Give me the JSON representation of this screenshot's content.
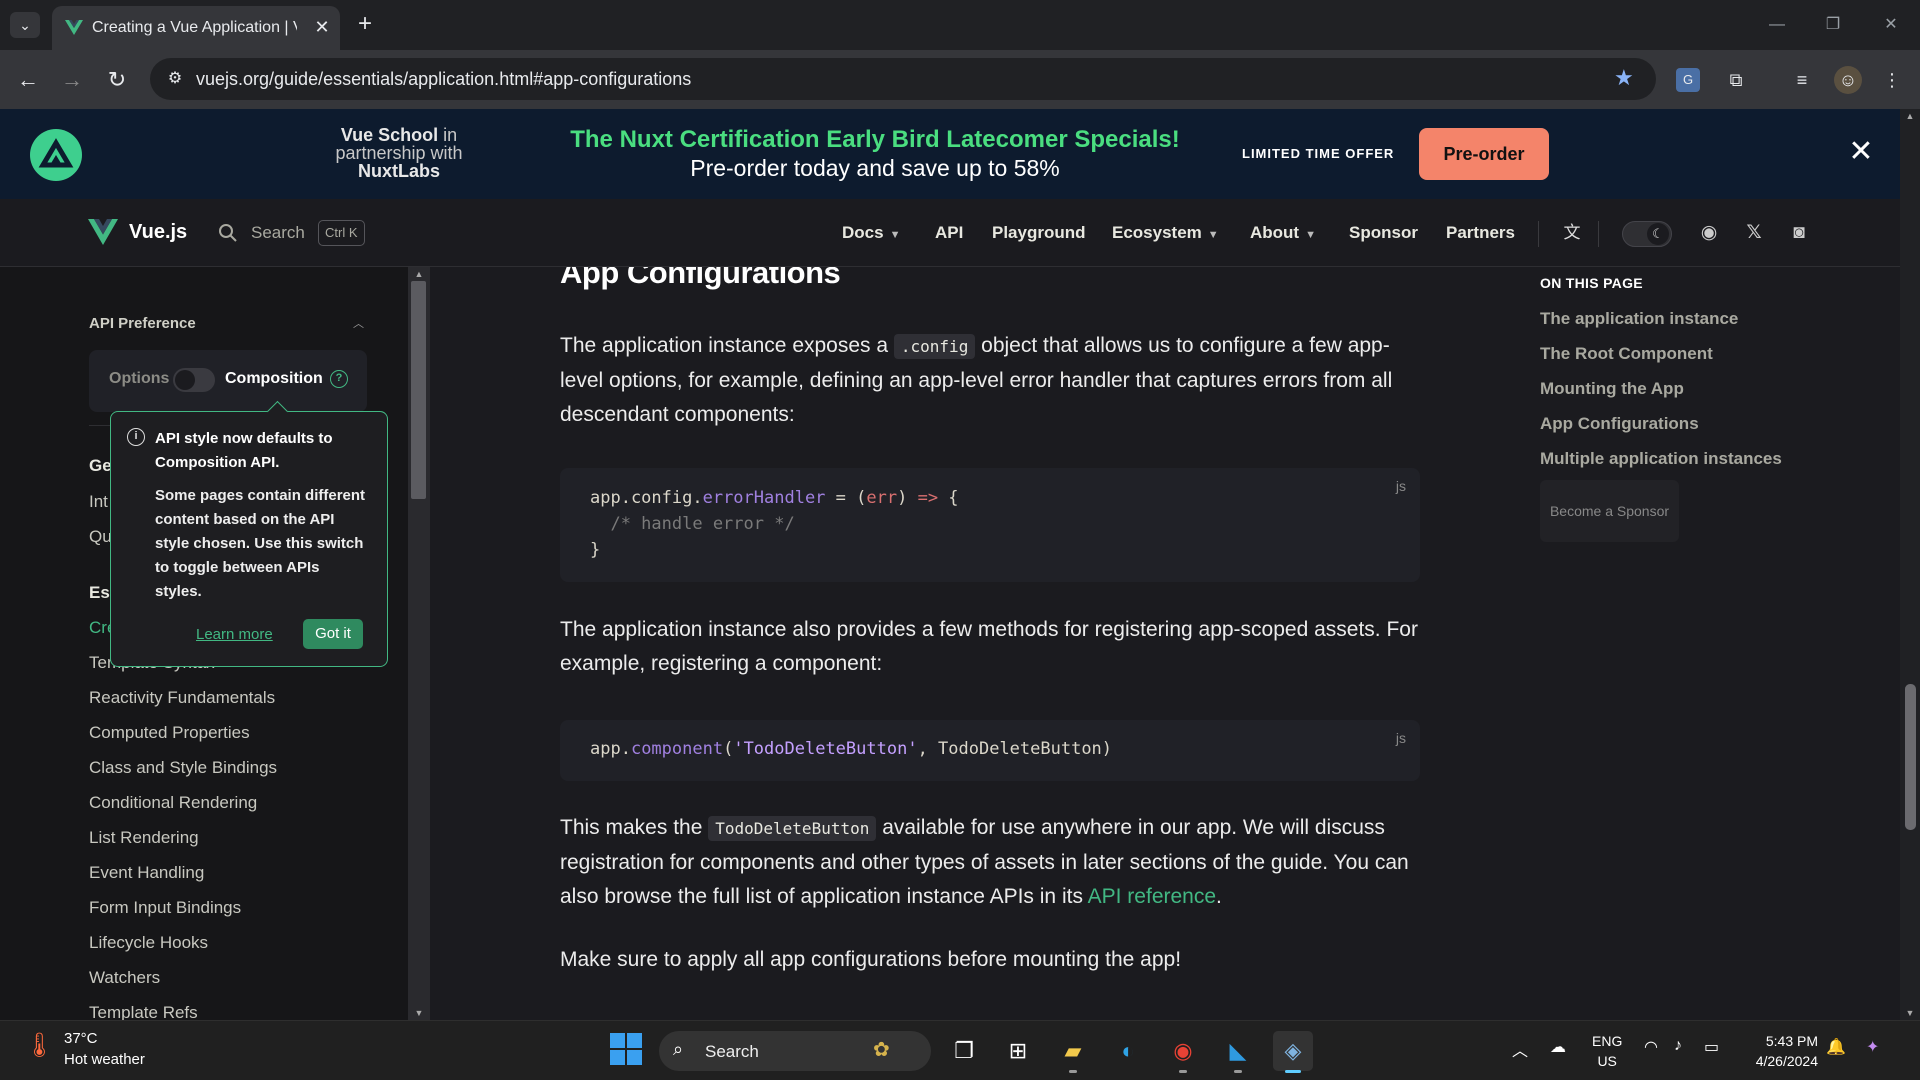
{
  "browser": {
    "tab_title": "Creating a Vue Application | Vue.js",
    "url": "vuejs.org/guide/essentials/application.html#app-configurations",
    "new_tab": "+",
    "close": "✕"
  },
  "banner": {
    "brand_line1": "Vue School",
    "brand_line1_suffix": " in",
    "brand_line2": "partnership with",
    "brand_line3": "NuxtLabs",
    "title": "The Nuxt Certification Early Bird Latecomer Specials!",
    "subtitle": "Pre-order today and save up to 58%",
    "offer": "LIMITED TIME OFFER",
    "cta": "Pre-order"
  },
  "nav": {
    "brand": "Vue.js",
    "search_label": "Search",
    "search_kbd": "Ctrl K",
    "links": [
      "Docs",
      "API",
      "Playground",
      "Ecosystem",
      "About",
      "Sponsor",
      "Partners"
    ]
  },
  "sidebar": {
    "api_pref_title": "API Preference",
    "options_label": "Options",
    "composition_label": "Composition",
    "group_partials": [
      "Ge",
      "Int",
      "Qu",
      "Es",
      "Cre"
    ],
    "template_partial": "Template Syntax",
    "items": [
      "Reactivity Fundamentals",
      "Computed Properties",
      "Class and Style Bindings",
      "Conditional Rendering",
      "List Rendering",
      "Event Handling",
      "Form Input Bindings",
      "Lifecycle Hooks",
      "Watchers",
      "Template Refs"
    ]
  },
  "tooltip": {
    "heading": "API style now defaults to Composition API.",
    "body": "Some pages contain different content based on the API style chosen. Use this switch to toggle between APIs styles.",
    "learn_more": "Learn more",
    "got_it": "Got it"
  },
  "content": {
    "heading": "App Configurations",
    "p1_before": "The application instance exposes a ",
    "p1_code": ".config",
    "p1_after": " object that allows us to configure a few app-level options, for example, defining an app-level error handler that captures errors from all descendant components:",
    "code1_lang": "js",
    "code1": {
      "l1a": "app.config.",
      "l1fn": "errorHandler",
      "l1b": " = (",
      "l1arg": "err",
      "l1c": ") ",
      "l1arrow": "=>",
      "l1d": " {",
      "l2": "  /* handle error */",
      "l3": "}"
    },
    "p2": "The application instance also provides a few methods for registering app-scoped assets. For example, registering a component:",
    "code2_lang": "js",
    "code2": {
      "a": "app.",
      "fn": "component",
      "b": "(",
      "str": "'TodoDeleteButton'",
      "c": ", TodoDeleteButton)"
    },
    "p3_before": "This makes the ",
    "p3_code": "TodoDeleteButton",
    "p3_mid": " available for use anywhere in our app. We will discuss registration for components and other types of assets in later sections of the guide. You can also browse the full list of application instance APIs in its ",
    "p3_link": "API reference",
    "p3_after": ".",
    "p4": "Make sure to apply all app configurations before mounting the app!"
  },
  "toc": {
    "title": "ON THIS PAGE",
    "links": [
      "The application instance",
      "The Root Component",
      "Mounting the App",
      "App Configurations",
      "Multiple application instances"
    ],
    "sponsor": "Become a Sponsor"
  },
  "taskbar": {
    "temp": "37°C",
    "weather": "Hot weather",
    "search": "Search",
    "lang1": "ENG",
    "lang2": "US",
    "time": "5:43 PM",
    "date": "4/26/2024"
  },
  "colors": {
    "vue_green": "#42b883",
    "promo_green": "#4ade80",
    "cta": "#f4846a",
    "bg": "#1b1b1f"
  }
}
